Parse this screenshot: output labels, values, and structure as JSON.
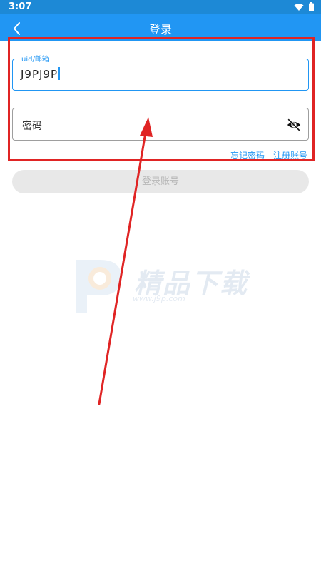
{
  "status_bar": {
    "time": "3:07",
    "icons": [
      "wifi-icon",
      "battery-icon"
    ]
  },
  "app_bar": {
    "title": "登录",
    "back_icon": "chevron-left-icon"
  },
  "form": {
    "uid_field": {
      "label": "uid/邮箱",
      "value": "J9PJ9P"
    },
    "password_field": {
      "placeholder": "密码",
      "toggle_icon": "eye-off-icon"
    },
    "forgot_password": "忘记密码",
    "register": "注册账号",
    "login_button": "登录账号"
  },
  "watermark": {
    "text": "精品下载",
    "url": "www.j9p.com"
  },
  "colors": {
    "status_bar": "#1d89d6",
    "app_bar": "#2196f3",
    "accent": "#2196f3",
    "annotation": "#e02424"
  }
}
